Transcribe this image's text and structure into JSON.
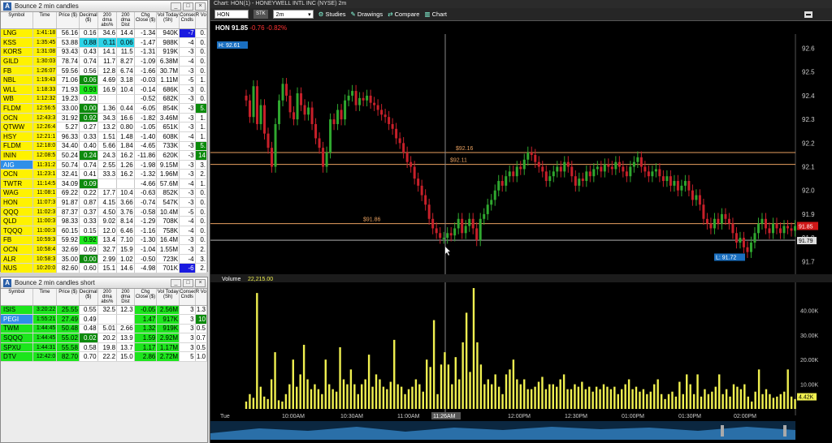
{
  "bounce2": {
    "title": "Bounce 2 min candles",
    "headers": [
      "Symbol",
      "Time",
      "Price ($)",
      "Decimal ($)",
      "200 dma abs%",
      "200 dma Dist",
      "Chg Close ($)",
      "Vol Today (Sh)",
      "Consec Cndls",
      "R Vo"
    ],
    "rows": [
      [
        "LNG",
        "1:41:18",
        "56.16",
        "0.16",
        "34.6",
        "14.4",
        "-1.34",
        "940K",
        "-7",
        "0."
      ],
      [
        "KSS",
        "1:35:45",
        "53.88",
        "0.88",
        "0.11",
        "0.06",
        "-1.47",
        "988K",
        "-4",
        "0."
      ],
      [
        "KORS",
        "1:31:08",
        "93.43",
        "0.43",
        "14.1",
        "11.5",
        "-1.31",
        "919K",
        "-3",
        "0."
      ],
      [
        "GILD",
        "1:30:03",
        "78.74",
        "0.74",
        "11.7",
        "8.27",
        "-1.09",
        "6.38M",
        "-4",
        "0."
      ],
      [
        "FB",
        "1:26:07",
        "59.56",
        "0.56",
        "12.8",
        "6.74",
        "-1.66",
        "30.7M",
        "-3",
        "0."
      ],
      [
        "NBL",
        "1:19:43",
        "71.06",
        "0.06",
        "4.69",
        "3.18",
        "-0.03",
        "1.11M",
        "-5",
        "1."
      ],
      [
        "WLL",
        "1:18:33",
        "71.93",
        "0.93",
        "16.9",
        "10.4",
        "-0.14",
        "686K",
        "-3",
        "0."
      ],
      [
        "WB",
        "1:12:32",
        "19.23",
        "0.23",
        "",
        "",
        "-0.52",
        "682K",
        "-3",
        "0."
      ],
      [
        "FLDM",
        "12:56:5",
        "33.00",
        "0.00",
        "1.36",
        "0.44",
        "-6.05",
        "854K",
        "-3",
        "5."
      ],
      [
        "OCN",
        "12:43:3",
        "31.92",
        "0.92",
        "34.3",
        "16.6",
        "-1.82",
        "3.46M",
        "-3",
        "1."
      ],
      [
        "QTWW",
        "12:26:4",
        "5.27",
        "0.27",
        "13.2",
        "0.80",
        "-1.05",
        "651K",
        "-3",
        "1."
      ],
      [
        "HSY",
        "12:21:1",
        "96.33",
        "0.33",
        "1.51",
        "1.48",
        "-1.40",
        "608K",
        "-4",
        "1."
      ],
      [
        "FLDM",
        "12:18:0",
        "34.40",
        "0.40",
        "5.66",
        "1.84",
        "-4.65",
        "733K",
        "-3",
        "5."
      ],
      [
        "ININ",
        "12:08:5",
        "50.24",
        "0.24",
        "24.3",
        "16.2",
        "-11.86",
        "620K",
        "-3",
        "14"
      ],
      [
        "AIG",
        "11:31:2",
        "50.74",
        "0.74",
        "2.55",
        "1.26",
        "-1.98",
        "9.15M",
        "-3",
        "3."
      ],
      [
        "OCN",
        "11:23:1",
        "32.41",
        "0.41",
        "33.3",
        "16.2",
        "-1.32",
        "1.96M",
        "-3",
        "2."
      ],
      [
        "TWTR",
        "11:14:5",
        "34.09",
        "0.09",
        "",
        "",
        "-4.66",
        "57.6M",
        "-4",
        "1."
      ],
      [
        "WAG",
        "11:08:1",
        "69.22",
        "0.22",
        "17.7",
        "10.4",
        "-0.63",
        "852K",
        "-3",
        "0."
      ],
      [
        "HON",
        "11:07:3",
        "91.87",
        "0.87",
        "4.15",
        "3.66",
        "-0.74",
        "547K",
        "-3",
        "0."
      ],
      [
        "QQQ",
        "11:02:3",
        "87.37",
        "0.37",
        "4.50",
        "3.76",
        "-0.58",
        "10.4M",
        "-5",
        "0."
      ],
      [
        "QLD",
        "11:00:3",
        "98.33",
        "0.33",
        "9.02",
        "8.14",
        "-1.29",
        "708K",
        "-4",
        "0."
      ],
      [
        "TQQQ",
        "11:00:3",
        "60.15",
        "0.15",
        "12.0",
        "6.46",
        "-1.16",
        "758K",
        "-4",
        "0."
      ],
      [
        "FB",
        "10:59:3",
        "59.92",
        "0.92",
        "13.4",
        "7.10",
        "-1.30",
        "16.4M",
        "-3",
        "0."
      ],
      [
        "OCN",
        "10:58:4",
        "32.69",
        "0.69",
        "32.7",
        "15.9",
        "-1.04",
        "1.55M",
        "-3",
        "2."
      ],
      [
        "ALR",
        "10:58:3",
        "35.00",
        "0.00",
        "2.99",
        "1.02",
        "-0.50",
        "723K",
        "-4",
        "3."
      ],
      [
        "NUS",
        "10:20:0",
        "82.60",
        "0.60",
        "15.1",
        "14.6",
        "-4.98",
        "701K",
        "-6",
        "2."
      ]
    ]
  },
  "bounce2short": {
    "title": "Bounce 2 min candles short",
    "headers": [
      "Symbol",
      "Time",
      "Price ($)",
      "Decimal ($)",
      "200 dma abs%",
      "200 dma Dist",
      "Chg Close ($)",
      "Vol Today (Sh)",
      "Consec Cndls",
      "R Vo"
    ],
    "rows": [
      [
        "ISIS",
        "3:20:22",
        "25.55",
        "0.55",
        "32.5",
        "12.3",
        "-0.05",
        "2.56M",
        "3",
        "1.3"
      ],
      [
        "PEGI",
        "1:55:21",
        "27.49",
        "0.49",
        "",
        "",
        "1.47",
        "917K",
        "3",
        "10"
      ],
      [
        "TWM",
        "1:44:45",
        "50.48",
        "0.48",
        "5.01",
        "2.66",
        "1.32",
        "919K",
        "3",
        "0.5"
      ],
      [
        "SQQQ",
        "1:44:45",
        "55.02",
        "0.02",
        "20.2",
        "13.9",
        "1.59",
        "2.92M",
        "3",
        "0.7"
      ],
      [
        "SPXU",
        "1:44:31",
        "55.58",
        "0.58",
        "19.8",
        "13.7",
        "1.17",
        "1.17M",
        "3",
        "0.5"
      ],
      [
        "DTV",
        "12:42:0",
        "82.70",
        "0.70",
        "22.2",
        "15.0",
        "2.86",
        "2.72M",
        "5",
        "1.0"
      ]
    ]
  },
  "chart": {
    "window_title": "Chart: HON(1) - HONEYWELL INTL INC (NYSE) 2m",
    "symbol": "HON",
    "stk": "STK",
    "interval": "2m",
    "toolbar": {
      "studies": "Studies",
      "drawings": "Drawings",
      "compare": "Compare",
      "chart": "Chart"
    },
    "quote": {
      "symbol": "HON",
      "last": "91.85",
      "change": "-0.76",
      "pct": "-0.82%"
    },
    "hi_label": "H: 92.61",
    "lo_label": "L: 91.72",
    "last_tag": "91.85",
    "cross_tag": "91.79",
    "hlines": [
      {
        "label": "$92.16",
        "value": 92.16
      },
      {
        "label": "$92.11",
        "value": 92.11
      },
      {
        "label": "$91.86",
        "value": 91.86
      }
    ],
    "volume_label": "Volume",
    "volume_value": "22,215.00",
    "volume_tag": "4.42K",
    "cursor_time": "11:26AM",
    "x_labels": [
      "Tue",
      "10:00AM",
      "10:30AM",
      "11:00AM",
      "12:00PM",
      "12:30PM",
      "01:00PM",
      "01:30PM",
      "02:00PM"
    ],
    "colors": {
      "up": "#2fa82f",
      "down": "#c8202a",
      "volume": "#f0f050",
      "hline": "#e8a060"
    }
  },
  "chart_data": {
    "type": "candlestick",
    "title": "HON 2m",
    "ylim": [
      91.66,
      92.66
    ],
    "yticks": [
      "92.6",
      "92.5",
      "92.4",
      "92.3",
      "92.2",
      "92.1",
      "92.0",
      "91.9",
      "91.8",
      "91.7"
    ],
    "volume_ylim": [
      0,
      50000
    ],
    "volume_ticks": [
      "40.00K",
      "30.00K",
      "20.00K",
      "10.00K"
    ],
    "closes": [
      92.38,
      92.31,
      92.44,
      92.28,
      92.36,
      92.24,
      92.18,
      92.1,
      92.28,
      92.38,
      92.45,
      92.4,
      92.33,
      92.3,
      92.41,
      92.36,
      92.32,
      92.35,
      92.28,
      92.22,
      92.18,
      92.1,
      92.16,
      92.3,
      92.28,
      92.34,
      92.3,
      92.38,
      92.4,
      92.42,
      92.36,
      92.39,
      92.38,
      92.4,
      92.37,
      92.36,
      92.34,
      92.32,
      92.31,
      92.28,
      92.26,
      92.22,
      92.2,
      92.16,
      92.12,
      92.1,
      92.05,
      92.02,
      91.98,
      91.94,
      91.88,
      91.84,
      91.82,
      91.8,
      91.8,
      91.82,
      91.81,
      91.84,
      91.88,
      91.82,
      91.85,
      91.88,
      91.84,
      91.79,
      91.88,
      91.9,
      91.94,
      91.96,
      92.0,
      92.04,
      92.02,
      92.06,
      92.08,
      92.06,
      92.1,
      92.09,
      92.13,
      92.16,
      92.15,
      92.12,
      92.1,
      92.08,
      92.04,
      92.06,
      92.08,
      92.1,
      92.08,
      92.12,
      92.1,
      92.06,
      92.02,
      92.05,
      92.04,
      92.08,
      92.06,
      92.09,
      92.1,
      92.08,
      92.11,
      92.1,
      92.09,
      92.12,
      92.1,
      92.08,
      92.06,
      92.1,
      92.12,
      92.14,
      92.1,
      92.08,
      92.06,
      92.08,
      92.09,
      92.06,
      92.04,
      92.06,
      92.02,
      92.04,
      92.0,
      92.02,
      92.04,
      92.0,
      91.96,
      91.98,
      91.94,
      91.88,
      91.86,
      91.84,
      91.88,
      91.86,
      91.9,
      91.88,
      91.86,
      91.82,
      91.78,
      91.8,
      91.76,
      91.74,
      91.78,
      91.82,
      91.86,
      91.88,
      91.84,
      91.82,
      91.86,
      91.84,
      91.82,
      91.85,
      91.84,
      91.83,
      91.85
    ],
    "volumes": [
      3000,
      6000,
      4500,
      47000,
      9000,
      5000,
      4000,
      12000,
      23000,
      3500,
      3000,
      6000,
      10000,
      20000,
      9000,
      14000,
      26000,
      12000,
      8000,
      10000,
      8000,
      6000,
      20000,
      10000,
      8000,
      7000,
      25000,
      12000,
      10000,
      16000,
      10000,
      6000,
      10000,
      12000,
      22000,
      9000,
      14000,
      12000,
      9000,
      8000,
      11000,
      28000,
      10000,
      9000,
      6000,
      8000,
      9000,
      12000,
      10000,
      7000,
      20000,
      17000,
      36000,
      6000,
      18000,
      23000,
      18000,
      10000,
      21000,
      12000,
      27000,
      39000,
      15000,
      49000,
      27000,
      18000,
      10000,
      12000,
      10000,
      14000,
      9000,
      6000,
      14000,
      16000,
      20000,
      12000,
      10000,
      12000,
      8000,
      8000,
      9000,
      11000,
      13000,
      8000,
      10000,
      10000,
      9000,
      12000,
      14000,
      8000,
      8000,
      10000,
      9000,
      11000,
      8000,
      9000,
      7000,
      9000,
      8000,
      10000,
      9000,
      8000,
      9000,
      6000,
      8000,
      10000,
      12000,
      8000,
      9000,
      7000,
      8000,
      6000,
      7000,
      10000,
      12000,
      6000,
      4000,
      6000,
      7000,
      5000,
      11000,
      6000,
      14000,
      10000,
      6000,
      14000,
      5000,
      8000,
      6000,
      7000,
      9000,
      14000,
      6000,
      8000,
      5000,
      10000,
      9000,
      8000,
      10000,
      5000,
      3000,
      7000,
      16000,
      6000,
      8000,
      6000,
      4500,
      5000,
      6000,
      7000,
      16000,
      5000,
      4000
    ]
  }
}
